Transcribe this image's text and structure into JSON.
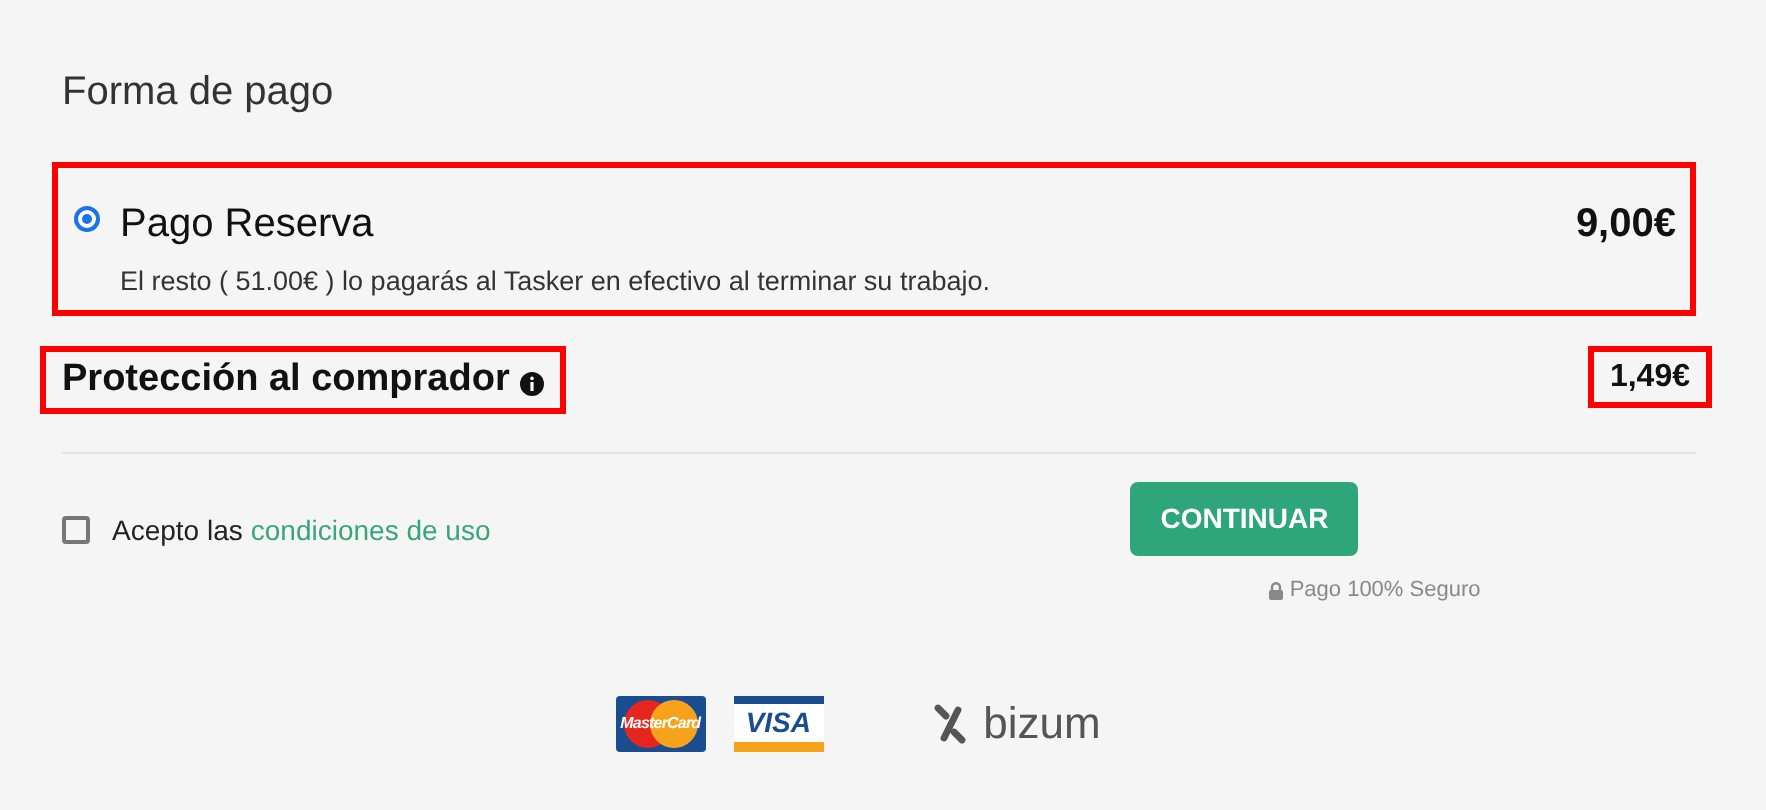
{
  "title": "Forma de pago",
  "payment_option": {
    "label": "Pago Reserva",
    "selected": true,
    "price": "9,00€",
    "note": "El resto ( 51.00€ ) lo pagarás al Tasker en efectivo al terminar su trabajo."
  },
  "protection": {
    "label": "Protección al comprador",
    "price": "1,49€"
  },
  "terms": {
    "prefix": "Acepto las",
    "link": "condiciones de uso",
    "checked": false
  },
  "continue_button": "CONTINUAR",
  "secure_note": "Pago 100% Seguro",
  "logos": [
    {
      "kind": "mastercard",
      "text": "MasterCard"
    },
    {
      "kind": "visa",
      "text": "VISA"
    },
    {
      "kind": "bizum",
      "text": "bizum"
    }
  ]
}
